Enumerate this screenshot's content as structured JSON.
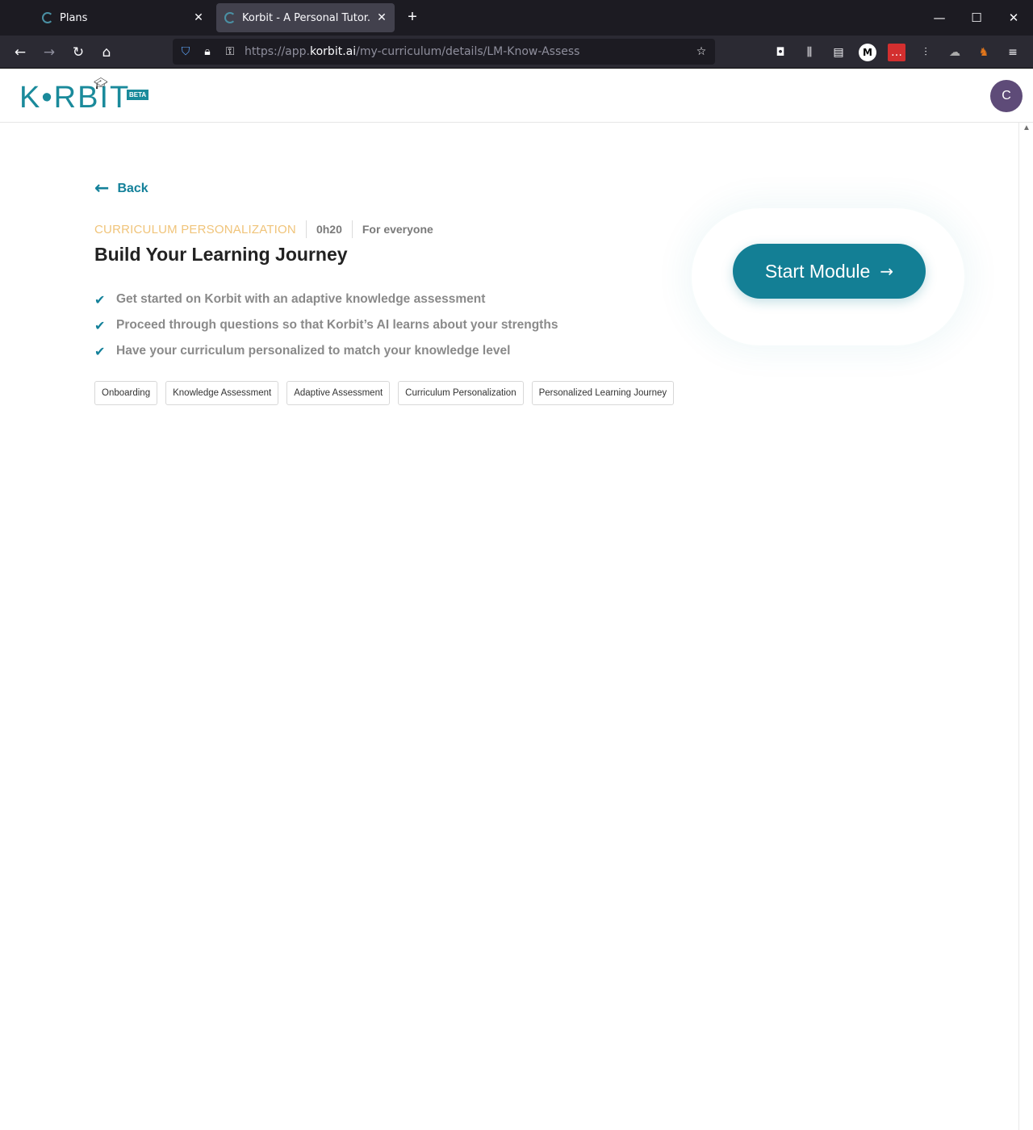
{
  "browser": {
    "tabs": [
      {
        "title": "Plans",
        "close": "✕"
      },
      {
        "title": "Korbit - A Personal Tutor. For Ev",
        "close": "✕"
      }
    ],
    "new_tab": "+",
    "window_controls": {
      "minimize": "—",
      "maximize": "☐",
      "close": "✕"
    },
    "url": {
      "prefix": "https://app.",
      "host": "korbit.ai",
      "path": "/my-curriculum/details/LM-Know-Assess"
    }
  },
  "app": {
    "logo_text": "K•RBIT",
    "beta_label": "BETA",
    "avatar_initial": "C"
  },
  "module": {
    "back_label": "Back",
    "category": "CURRICULUM PERSONALIZATION",
    "duration": "0h20",
    "audience": "For everyone",
    "title": "Build Your Learning Journey",
    "bullets": [
      "Get started on Korbit with an adaptive knowledge assessment",
      "Proceed through questions so that Korbit’s AI learns about your strengths",
      "Have your curriculum personalized to match your knowledge level"
    ],
    "tags": [
      "Onboarding",
      "Knowledge Assessment",
      "Adaptive Assessment",
      "Curriculum Personalization",
      "Personalized Learning Journey"
    ],
    "start_label": "Start Module"
  },
  "colors": {
    "accent": "#137f95",
    "category": "#f0c47a",
    "avatar": "#5e4b78"
  }
}
